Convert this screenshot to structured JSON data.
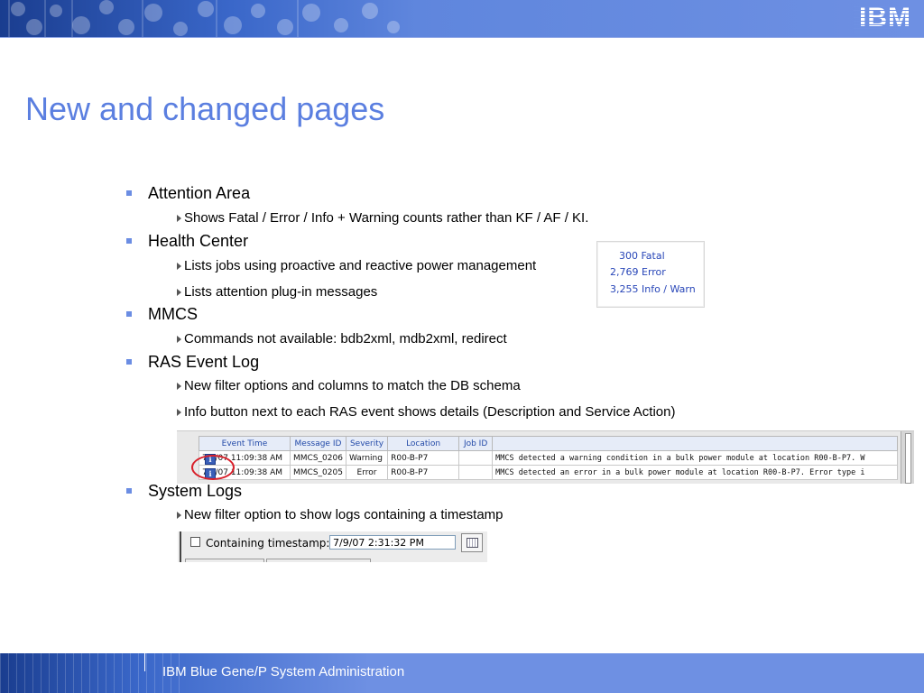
{
  "header": {
    "logo": "IBM"
  },
  "title": "New and changed pages",
  "bullets": [
    {
      "label": "Attention Area",
      "subs": [
        "Shows Fatal / Error / Info + Warning counts rather than KF / AF / KI."
      ]
    },
    {
      "label": "Health Center",
      "subs": [
        "Lists jobs using proactive and reactive power management",
        "Lists attention plug-in messages"
      ]
    },
    {
      "label": "MMCS",
      "subs": [
        "Commands not available: bdb2xml, mdb2xml, redirect"
      ]
    },
    {
      "label": "RAS Event Log",
      "subs": [
        "New filter options and columns to match the DB schema",
        "Info button next to each RAS event shows details (Description and Service Action)"
      ]
    },
    {
      "label": "System Logs",
      "subs": [
        "New filter option to show logs containing a timestamp"
      ]
    }
  ],
  "attention": {
    "fatal": "300 Fatal",
    "error": "2,769 Error",
    "info_warn": "3,255 Info / Warn",
    "link_color": "#2846b8"
  },
  "ras_table": {
    "columns": [
      "Event Time",
      "Message ID",
      "Severity",
      "Location",
      "Job ID",
      ""
    ],
    "rows": [
      [
        "7/9/07 11:09:38 AM",
        "MMCS_0206",
        "Warning",
        "R00-B-P7",
        "",
        "MMCS detected a warning condition in a bulk power module at location R00-B-P7.  W"
      ],
      [
        "7/9/07 11:09:38 AM",
        "MMCS_0205",
        "Error",
        "R00-B-P7",
        "",
        "MMCS detected an error in a bulk power module at location R00-B-P7.  Error type i"
      ]
    ],
    "info_icon": "info-icon"
  },
  "timestamp_filter": {
    "label": "Containing timestamp:",
    "value": "7/9/07 2:31:32 PM",
    "calendar_icon": "calendar-icon"
  },
  "footer": {
    "text": "IBM Blue Gene/P System Administration"
  },
  "colors": {
    "title": "#5b7fe0",
    "bullet": "#6b8de3",
    "banner": "#6e90e3",
    "highlight_circle": "#d8202a"
  }
}
